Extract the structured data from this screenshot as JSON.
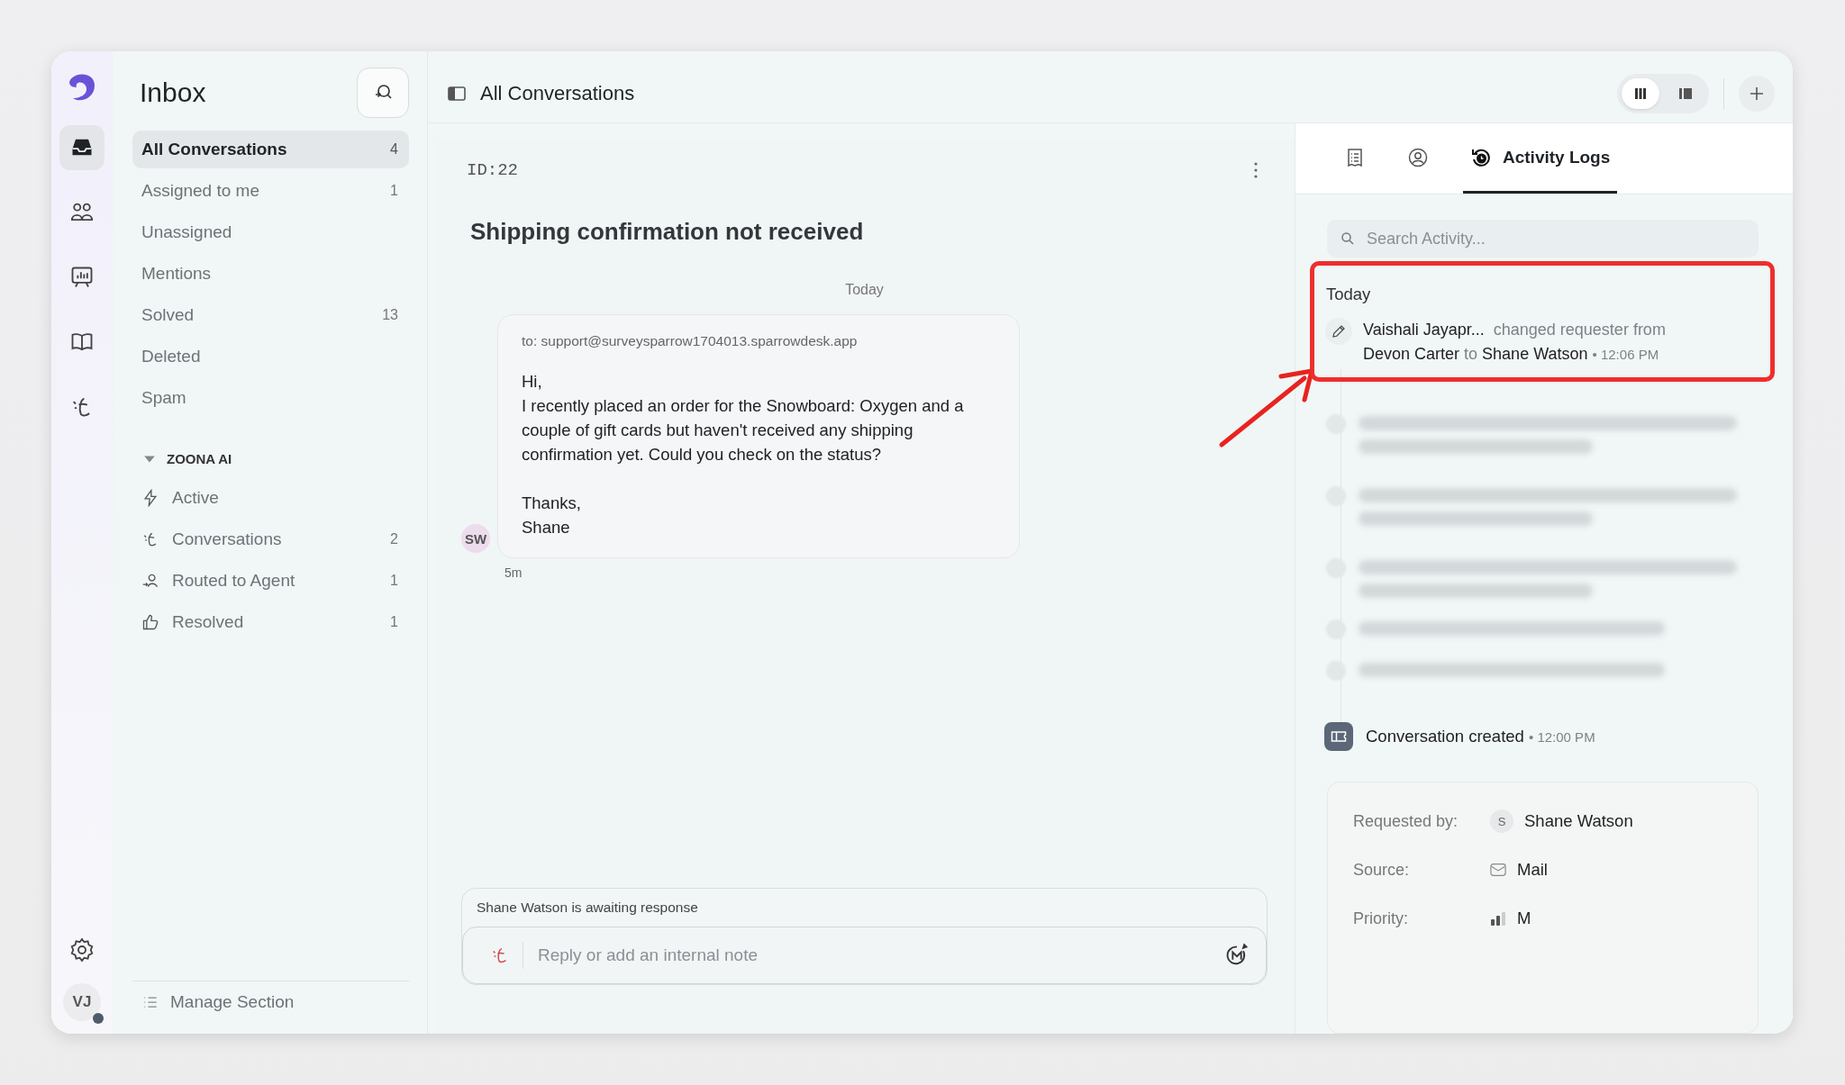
{
  "rail": {
    "items": [
      {
        "kind": "inbox",
        "selected": true
      },
      {
        "kind": "people",
        "selected": false
      },
      {
        "kind": "reports",
        "selected": false
      },
      {
        "kind": "book",
        "selected": false
      },
      {
        "kind": "ai",
        "selected": false
      }
    ],
    "avatar": {
      "initials": "VJ",
      "online": true
    }
  },
  "sidebar": {
    "title": "Inbox",
    "items": [
      {
        "label": "All Conversations",
        "count": "4",
        "selected": true
      },
      {
        "label": "Assigned to me",
        "count": "1",
        "selected": false
      },
      {
        "label": "Unassigned",
        "selected": false
      },
      {
        "label": "Mentions",
        "selected": false
      },
      {
        "label": "Solved",
        "count": "13",
        "selected": false
      },
      {
        "label": "Deleted",
        "selected": false
      },
      {
        "label": "Spam",
        "selected": false
      }
    ],
    "section": {
      "title": "ZOONA AI",
      "expanded": true,
      "items": [
        {
          "kind": "bolt",
          "label": "Active",
          "selected": false
        },
        {
          "kind": "ai",
          "label": "Conversations",
          "count": "2",
          "selected": false
        },
        {
          "kind": "agent",
          "label": "Routed to Agent",
          "count": "1",
          "selected": false
        },
        {
          "kind": "thumb",
          "label": "Resolved",
          "count": "1",
          "selected": false
        }
      ]
    },
    "footer": "Manage Section"
  },
  "header": {
    "title": "All Conversations",
    "views": [
      {
        "kind": "columns",
        "selected": true
      },
      {
        "kind": "panel",
        "selected": false
      }
    ]
  },
  "conversation": {
    "id": "ID:22",
    "subject": "Shipping confirmation not received",
    "day": "Today",
    "message": {
      "to": "to: support@surveysparrow1704013.sparrowdesk.app",
      "paragraphs": [
        [
          "Hi,",
          "I recently placed an order for the Snowboard: Oxygen and a couple of gift cards but haven't received any shipping confirmation yet. Could you check on the status?"
        ],
        [
          "Thanks,",
          "Shane"
        ]
      ],
      "avatar": "SW",
      "time": "5m"
    },
    "status": "Shane Watson is awaiting response",
    "reply": {
      "placeholder": "Reply or add an internal note"
    }
  },
  "details": {
    "tabs": [
      {
        "kind": "details",
        "selected": false
      },
      {
        "kind": "contact",
        "selected": false
      },
      {
        "kind": "activity",
        "label": "Activity Logs",
        "selected": true
      }
    ],
    "search": {
      "placeholder": "Search Activity..."
    },
    "day": "Today",
    "entries": [
      {
        "kind": "change",
        "highlighted": true,
        "actor": "Vaishali Jayapr...",
        "action": "changed requester from",
        "from": "Devon Carter",
        "joiner": "to",
        "to": "Shane Watson",
        "separator": "•",
        "time": "12:06 PM"
      },
      {
        "kind": "blurred"
      },
      {
        "kind": "blurred"
      },
      {
        "kind": "blurred"
      },
      {
        "kind": "blurredline"
      },
      {
        "kind": "blurredline"
      },
      {
        "kind": "created",
        "text": "Conversation created",
        "separator": "•",
        "time": "12:00 PM"
      }
    ],
    "info": [
      {
        "kind": "person",
        "label": "Requested by:",
        "avatar": "S",
        "value": "Shane Watson"
      },
      {
        "kind": "mail",
        "label": "Source:",
        "value": "Mail"
      },
      {
        "kind": "priority",
        "label": "Priority:",
        "value": "M"
      }
    ]
  }
}
